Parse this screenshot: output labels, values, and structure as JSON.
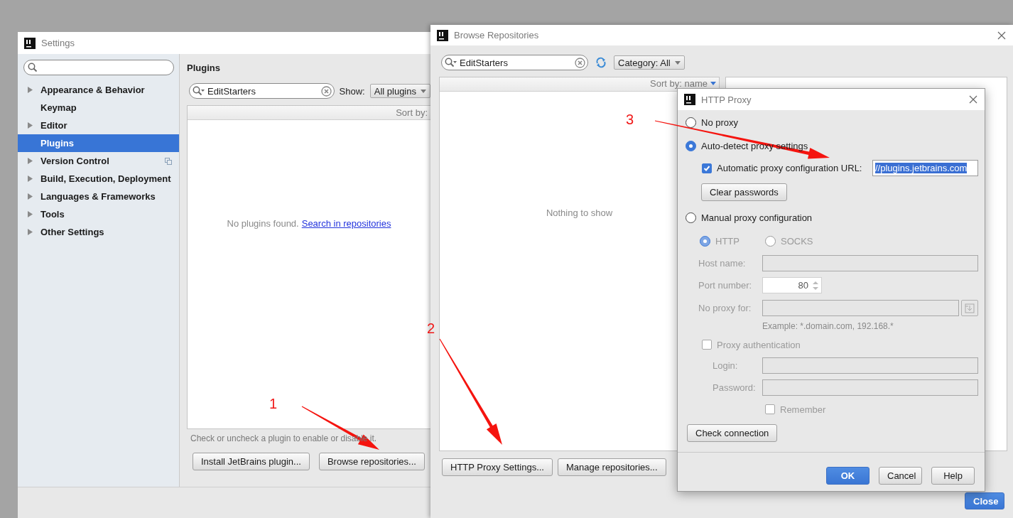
{
  "settings": {
    "title": "Settings",
    "sidebar": [
      {
        "label": "Appearance & Behavior",
        "expandable": true,
        "selected": false
      },
      {
        "label": "Keymap",
        "expandable": false,
        "selected": false
      },
      {
        "label": "Editor",
        "expandable": true,
        "selected": false
      },
      {
        "label": "Plugins",
        "expandable": false,
        "selected": true
      },
      {
        "label": "Version Control",
        "expandable": true,
        "selected": false,
        "project_icon": true
      },
      {
        "label": "Build, Execution, Deployment",
        "expandable": true,
        "selected": false
      },
      {
        "label": "Languages & Frameworks",
        "expandable": true,
        "selected": false
      },
      {
        "label": "Tools",
        "expandable": true,
        "selected": false
      },
      {
        "label": "Other Settings",
        "expandable": true,
        "selected": false
      }
    ],
    "heading": "Plugins",
    "search_value": "EditStarters",
    "show_label": "Show:",
    "show_value": "All plugins",
    "sort_label": "Sort by:",
    "empty_text": "No plugins found.",
    "empty_link": "Search in repositories",
    "hint": "Check or uncheck a plugin to enable or disable it.",
    "buttons": [
      "Install JetBrains plugin...",
      "Browse repositories..."
    ]
  },
  "browse": {
    "title": "Browse Repositories",
    "search_value": "EditStarters",
    "category": "Category: All",
    "sort_label": "Sort by: name",
    "empty_text": "Nothing to show",
    "buttons": [
      "HTTP Proxy Settings...",
      "Manage repositories..."
    ],
    "close_button": "Close"
  },
  "proxy": {
    "title": "HTTP Proxy",
    "no_proxy": {
      "label": "No proxy",
      "selected": false
    },
    "auto_detect": {
      "label": "Auto-detect proxy settings",
      "selected": true
    },
    "auto_url": {
      "label": "Automatic proxy configuration URL:",
      "checked": true,
      "value": "//plugins.jetbrains.com"
    },
    "clear_passwords": "Clear passwords",
    "manual": {
      "label": "Manual proxy configuration",
      "selected": false
    },
    "manual_settings": {
      "disabled": true,
      "protocols": [
        {
          "label": "HTTP",
          "selected": true
        },
        {
          "label": "SOCKS",
          "selected": false
        }
      ],
      "host_label": "Host name:",
      "port_label": "Port number:",
      "port_value": "80",
      "no_proxy_label": "No proxy for:",
      "example": "Example: *.domain.com, 192.168.*",
      "auth": {
        "label": "Proxy authentication",
        "checked": false
      },
      "login_label": "Login:",
      "password_label": "Password:",
      "remember": {
        "label": "Remember",
        "checked": false
      }
    },
    "check_connection": "Check connection",
    "buttons": [
      {
        "label": "OK",
        "primary": true
      },
      {
        "label": "Cancel",
        "primary": false
      },
      {
        "label": "Help",
        "primary": false
      }
    ]
  },
  "annotations": [
    {
      "label": "1"
    },
    {
      "label": "2"
    },
    {
      "label": "3"
    }
  ]
}
